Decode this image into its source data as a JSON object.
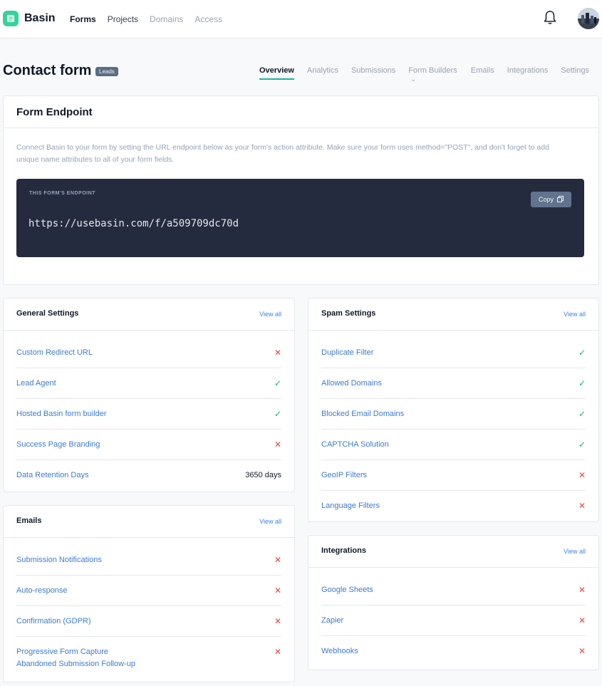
{
  "app": {
    "name": "Basin"
  },
  "nav": {
    "items": [
      "Forms",
      "Projects",
      "Domains",
      "Access"
    ]
  },
  "header": {
    "title": "Contact form",
    "badge": "Leads",
    "tabs": [
      "Overview",
      "Analytics",
      "Submissions",
      "Form Builders",
      "Emails",
      "Integrations",
      "Settings"
    ]
  },
  "endpoint": {
    "title": "Form Endpoint",
    "description": "Connect Basin to your form by setting the URL endpoint below as your form's action attribute. Make sure your form uses method=\"POST\", and don't forget to add unique name attributes to all of your form fields.",
    "label": "THIS FORM'S ENDPOINT",
    "url": "https://usebasin.com/f/a509709dc70d",
    "copy_label": "Copy"
  },
  "general": {
    "title": "General Settings",
    "view_all": "View all",
    "rows": [
      {
        "label": "Custom Redirect URL",
        "status": "✕"
      },
      {
        "label": "Lead Agent",
        "status": "✓"
      },
      {
        "label": "Hosted Basin form builder",
        "status": "✓"
      },
      {
        "label": "Success Page Branding",
        "status": "✕"
      },
      {
        "label": "Data Retention Days",
        "value": "3650 days"
      }
    ]
  },
  "spam": {
    "title": "Spam Settings",
    "view_all": "View all",
    "rows": [
      {
        "label": "Duplicate Filter",
        "status": "✓"
      },
      {
        "label": "Allowed Domains",
        "status": "✓"
      },
      {
        "label": "Blocked Email Domains",
        "status": "✓"
      },
      {
        "label": "CAPTCHA Solution",
        "status": "✓"
      },
      {
        "label": "GeoIP Filters",
        "status": "✕"
      },
      {
        "label": "Language Filters",
        "status": "✕"
      }
    ]
  },
  "emails": {
    "title": "Emails",
    "view_all": "View all",
    "rows": [
      {
        "label": "Submission Notifications",
        "status": "✕"
      },
      {
        "label": "Auto-response",
        "status": "✕"
      },
      {
        "label": "Confirmation (GDPR)",
        "status": "✕"
      },
      {
        "label": "Progressive Form Capture",
        "label2": "Abandoned Submission Follow-up",
        "status": "✕"
      }
    ]
  },
  "integrations": {
    "title": "Integrations",
    "view_all": "View all",
    "rows": [
      {
        "label": "Google Sheets",
        "status": "✕"
      },
      {
        "label": "Zapier",
        "status": "✕"
      },
      {
        "label": "Webhooks",
        "status": "✕"
      }
    ]
  }
}
